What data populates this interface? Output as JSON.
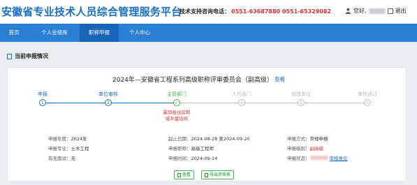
{
  "header": {
    "app_title": "安徽省专业技术人员综合管理服务平台",
    "hotline_label": "技术支持咨询电话：",
    "hotline_numbers": "0551-63687880  0551-65329082",
    "user_greeting": "您好,",
    "logout_label": "退出"
  },
  "nav": {
    "items": [
      {
        "label": "首页",
        "active": false
      },
      {
        "label": "个人业绩库",
        "active": false
      },
      {
        "label": "职称申报",
        "active": true
      },
      {
        "label": "个人中心",
        "active": false
      }
    ]
  },
  "section": {
    "title": "当前申报情况"
  },
  "card": {
    "title": "2024年—安徽省工程系列高级职称评审委员会（副高级）",
    "view_link": "查看",
    "steps": [
      {
        "label": "申报",
        "number": "1",
        "state": "done"
      },
      {
        "label": "单位审核",
        "number": "2",
        "state": "done"
      },
      {
        "label": "主管部门",
        "number": "✓",
        "state": "current"
      },
      {
        "label": "人社部门",
        "number": "4",
        "state": "pending"
      },
      {
        "label": "指建单位",
        "number": "5",
        "state": "pending"
      },
      {
        "label": "审核通过",
        "number": "6",
        "state": "pending"
      }
    ],
    "step_note": "霍邱县住房和城乡建设局",
    "info": {
      "year_label": "申报年度：",
      "year_value": "2024年",
      "date_label": "起止日期：",
      "date_value": "2024-08-28 至2024-09-20",
      "method_label": "申报方式：",
      "method_value": "常规申报",
      "major_label": "申报专业：",
      "major_value": "土木工程",
      "title_label": "申报职称：",
      "title_value": "高级工程师",
      "level_label": "申报级别：",
      "level_value": "副高级",
      "interview_label": "有无面试：",
      "interview_value": "无",
      "time_label": "申报时间：",
      "time_value": "2024-09-14",
      "status_label": "申报状态：",
      "status_link": "审核意见"
    },
    "buttons": {
      "view_label": "查看",
      "export_label": "导出评审表"
    }
  },
  "colors": {
    "brand": "#1a6fc2",
    "nav": "#2b7fd6",
    "done": "#1a6fc2",
    "current": "#4caf50",
    "pending": "#b9bdc3",
    "alert": "#d33333"
  }
}
